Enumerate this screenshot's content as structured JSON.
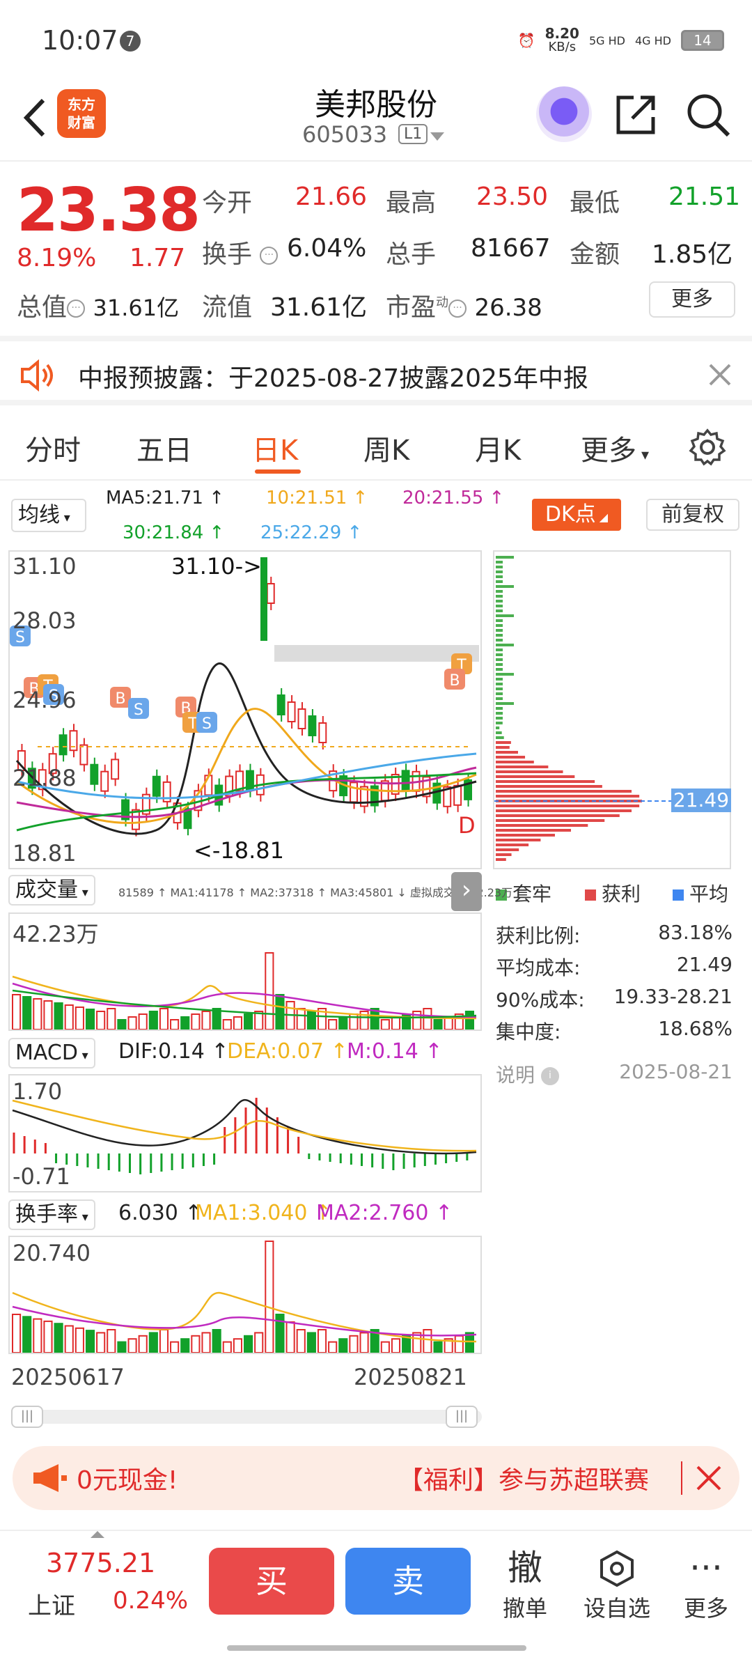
{
  "status_bar": {
    "time": "10:07",
    "notif_count": "7",
    "net_speed": "8.20",
    "net_unit": "KB/s",
    "net1": "5G HD",
    "net2": "4G HD",
    "battery": "14"
  },
  "header": {
    "logo_text_line1": "东方",
    "logo_text_line2": "财富",
    "stock_name": "美邦股份",
    "stock_code": "605033",
    "level": "L1"
  },
  "quote": {
    "price": "23.38",
    "change_pct": "8.19%",
    "change": "1.77",
    "open_label": "今开",
    "open": "21.66",
    "high_label": "最高",
    "high": "23.50",
    "low_label": "最低",
    "low": "21.51",
    "turnover_label": "换手",
    "turnover": "6.04%",
    "volume_label": "总手",
    "volume": "81667",
    "amount_label": "金额",
    "amount": "1.85亿",
    "mktcap_label": "总值",
    "mktcap": "31.61亿",
    "float_label": "流值",
    "float_cap": "31.61亿",
    "pe_label": "市盈",
    "pe_sup": "动",
    "pe": "26.38",
    "more_label": "更多"
  },
  "notice": {
    "text": "中报预披露：于2025-08-27披露2025年中报"
  },
  "tabs": [
    {
      "label": "分时"
    },
    {
      "label": "五日"
    },
    {
      "label": "日K"
    },
    {
      "label": "周K"
    },
    {
      "label": "月K"
    },
    {
      "label": "更多"
    }
  ],
  "ma_bar": {
    "select": "均线",
    "ma5": "MA5:21.71",
    "ma10": "10:21.51",
    "ma20": "20:21.55",
    "ma30": "30:21.84",
    "ma25": "25:22.29",
    "dk": "DK点",
    "fq": "前复权",
    "colors": {
      "ma5": "#222222",
      "ma10": "#f0a81c",
      "ma20": "#c02a9a",
      "ma30": "#12a12a",
      "ma25": "#4aa8e8"
    }
  },
  "kline": {
    "y_top": "31.10",
    "y_2": "28.03",
    "y_3": "24.96",
    "y_4": "21.88",
    "y_bottom": "18.81",
    "max_mark": "31.10->",
    "min_mark": "<-18.81",
    "d_mark": "D"
  },
  "volume_panel": {
    "select": "成交量",
    "legend": "81589 ↑  MA1:41178 ↑  MA2:37318 ↑  MA3:45801 ↓  虚拟成交量:42.23万",
    "y_top": "42.23万"
  },
  "macd_panel": {
    "select": "MACD",
    "dif": "DIF:0.14",
    "dea": "DEA:0.07",
    "m": "M:0.14",
    "y_top": "1.70",
    "y_bottom": "-0.71"
  },
  "turnover_panel": {
    "select": "换手率",
    "val": "6.030",
    "ma1": "MA1:3.040",
    "ma2": "MA2:2.760",
    "y_top": "20.740",
    "date_start": "20250617",
    "date_end": "20250821"
  },
  "chips": {
    "price_tag": "21.49",
    "legend_trapped": "套牢",
    "legend_profit": "获利",
    "legend_avg": "平均",
    "profit_ratio_label": "获利比例:",
    "profit_ratio": "83.18%",
    "avg_cost_label": "平均成本:",
    "avg_cost": "21.49",
    "cost90_label": "90%成本:",
    "cost90": "19.33-28.21",
    "concentration_label": "集中度:",
    "concentration": "18.68%",
    "note_label": "说明",
    "date": "2025-08-21"
  },
  "ad": {
    "left_text": "0元现金!",
    "right_text": "【福利】参与苏超联赛"
  },
  "bottom": {
    "index_value": "3775.21",
    "index_name": "上证",
    "index_pct": "0.24%",
    "buy": "买",
    "sell": "卖",
    "cancel_icon": "撤",
    "cancel_label": "撤单",
    "watch_label": "设自选",
    "more_label": "更多"
  }
}
